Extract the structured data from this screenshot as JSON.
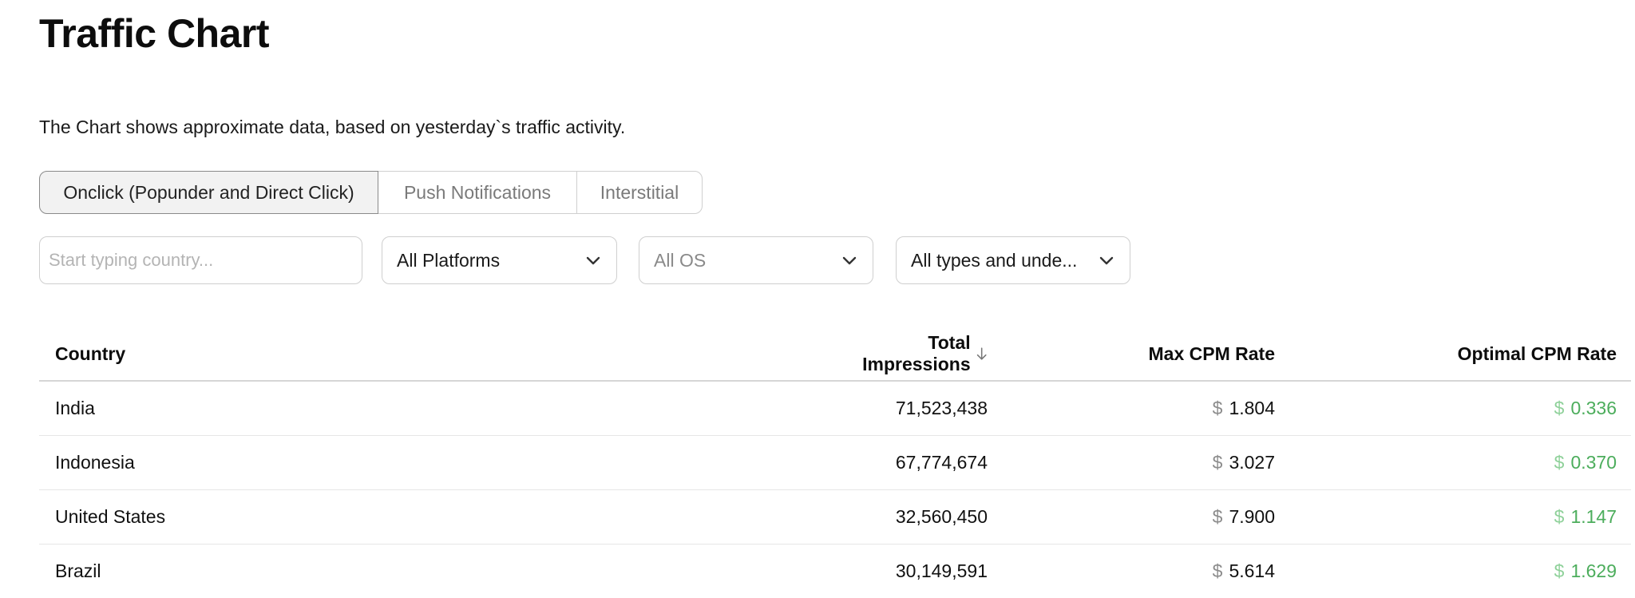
{
  "header": {
    "title": "Traffic Chart",
    "subtitle": "The Chart shows approximate data, based on yesterday`s traffic activity."
  },
  "tabs": [
    {
      "label": "Onclick (Popunder and Direct Click)",
      "active": true
    },
    {
      "label": "Push Notifications",
      "active": false
    },
    {
      "label": "Interstitial",
      "active": false
    }
  ],
  "filters": {
    "search_placeholder": "Start typing country...",
    "search_value": "",
    "platform": "All Platforms",
    "os": "All OS",
    "types": "All types and unde..."
  },
  "table": {
    "columns": {
      "country": "Country",
      "impressions": "Total Impressions",
      "max_cpm": "Max CPM Rate",
      "optimal_cpm": "Optimal CPM Rate"
    },
    "sort": {
      "column": "impressions",
      "direction": "desc",
      "icon": "arrow-down-icon"
    },
    "currency_symbol": "$",
    "rows": [
      {
        "country": "India",
        "impressions": "71,523,438",
        "max_cpm": "1.804",
        "optimal_cpm": "0.336"
      },
      {
        "country": "Indonesia",
        "impressions": "67,774,674",
        "max_cpm": "3.027",
        "optimal_cpm": "0.370"
      },
      {
        "country": "United States",
        "impressions": "32,560,450",
        "max_cpm": "7.900",
        "optimal_cpm": "1.147"
      },
      {
        "country": "Brazil",
        "impressions": "30,149,591",
        "max_cpm": "5.614",
        "optimal_cpm": "1.629"
      }
    ]
  },
  "colors": {
    "optimal_value": "#4cad5c",
    "optimal_currency": "#8fd19a",
    "border": "#cfcfcf",
    "active_tab_bg": "#f2f2f2"
  }
}
